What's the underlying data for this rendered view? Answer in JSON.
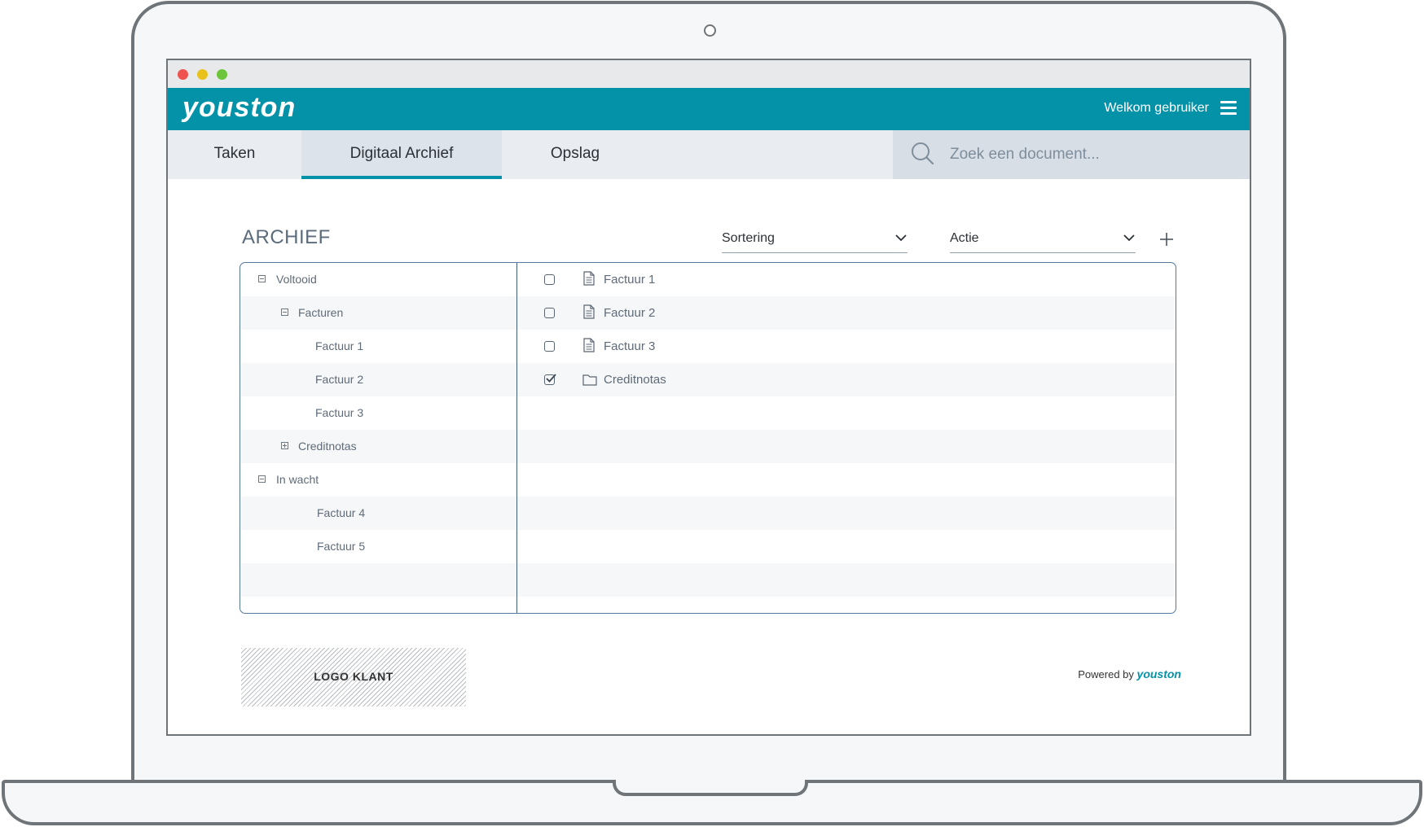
{
  "app": {
    "brand": "youston",
    "welcome": "Welkom gebruiker"
  },
  "nav": {
    "tabs": [
      {
        "label": "Taken",
        "active": false
      },
      {
        "label": "Digitaal Archief",
        "active": true
      },
      {
        "label": "Opslag",
        "active": false
      }
    ],
    "search_placeholder": "Zoek een document..."
  },
  "archive": {
    "title": "ARCHIEF",
    "sort_label": "Sortering",
    "action_label": "Actie",
    "tree": [
      {
        "label": "Voltooid",
        "toggle": "collapse"
      },
      {
        "label": "Facturen",
        "toggle": "collapse"
      },
      {
        "label": "Factuur 1",
        "toggle": null
      },
      {
        "label": "Factuur 2",
        "toggle": null
      },
      {
        "label": "Factuur 3",
        "toggle": null
      },
      {
        "label": "Creditnotas",
        "toggle": "expand"
      },
      {
        "label": "In wacht",
        "toggle": "collapse"
      },
      {
        "label": "Factuur 4",
        "toggle": null
      },
      {
        "label": "Factuur 5",
        "toggle": null
      }
    ],
    "files": [
      {
        "label": "Factuur 1",
        "type": "file",
        "checked": false
      },
      {
        "label": "Factuur 2",
        "type": "file",
        "checked": false
      },
      {
        "label": "Factuur 3",
        "type": "file",
        "checked": false
      },
      {
        "label": "Creditnotas",
        "type": "folder",
        "checked": true
      }
    ]
  },
  "footer": {
    "client_logo": "LOGO KLANT",
    "powered_by": "Powered by",
    "powered_brand": "youston"
  },
  "colors": {
    "accent": "#0492a9",
    "nav_bg": "#e9ecf0",
    "panel_border": "#56789a"
  }
}
